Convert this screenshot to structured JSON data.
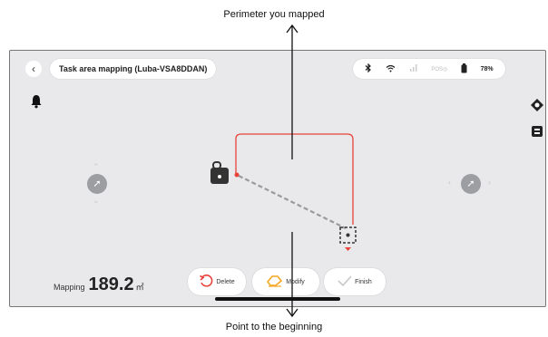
{
  "annotations": {
    "top": "Perimeter you mapped",
    "bottom": "Point to the beginning"
  },
  "header": {
    "back_icon": "chevron-left-icon",
    "title": "Task area mapping  (Luba-VSA8DDAN)"
  },
  "status": {
    "bluetooth_icon": "bluetooth-icon",
    "wifi_icon": "wifi-icon",
    "signal_icon": "cellular-signal-icon",
    "pos_label": "POS",
    "battery_icon": "battery-icon",
    "battery": "78%"
  },
  "mapping": {
    "label": "Mapping",
    "value": "189.2",
    "unit": "㎡"
  },
  "actions": {
    "delete": "Delete",
    "modify": "Modify",
    "finish": "Finish"
  },
  "colors": {
    "path_red": "#e8423a",
    "path_dashed": "#9a9a9a",
    "modify_orange": "#f5a623"
  }
}
